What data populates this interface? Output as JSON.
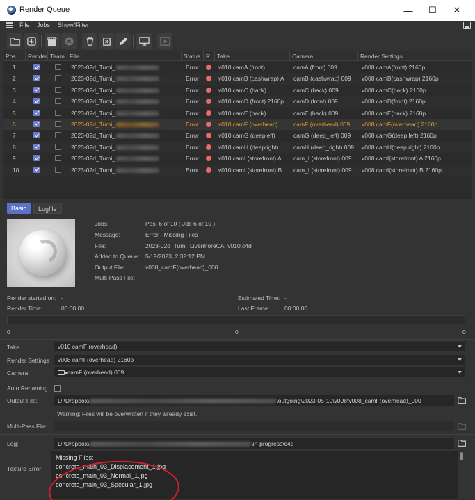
{
  "window": {
    "title": "Render Queue",
    "minimize": "—",
    "maximize": "☐",
    "close": "✕"
  },
  "menu": {
    "items": [
      "File",
      "Jobs",
      "Show/Filter"
    ]
  },
  "toolbar": {
    "icons": [
      "open-folder-icon",
      "download-icon",
      "clapperboard-icon",
      "stop-icon",
      "delete-icon",
      "delete-all-icon",
      "edit-icon",
      "monitor-icon",
      "render-view-icon"
    ]
  },
  "table": {
    "columns": [
      "Pos.",
      "Render",
      "Team",
      "File",
      "Status",
      "R",
      "Take",
      "Camera",
      "Render Settings"
    ],
    "rows": [
      {
        "pos": "1",
        "render": true,
        "team": false,
        "file": "2023-02d_Tumi_",
        "status": "Error",
        "take": "v010 camA (front)",
        "camera": "camA (front) 009",
        "settings": "v008.camA(front) 2160p"
      },
      {
        "pos": "2",
        "render": true,
        "team": false,
        "file": "2023-02d_Tumi_",
        "status": "Error",
        "take": "v010 camB (cashwrap) A",
        "camera": "camB (cashwrap) 009",
        "settings": "v008 camB(cashwrap) 2160p"
      },
      {
        "pos": "3",
        "render": true,
        "team": false,
        "file": "2023-02d_Tumi_",
        "status": "Error",
        "take": "v010 camC (back)",
        "camera": "camC (back) 009",
        "settings": "v008 camC(back) 2160p"
      },
      {
        "pos": "4",
        "render": true,
        "team": false,
        "file": "2023-02d_Tumi_",
        "status": "Error",
        "take": "v010 camD (front) 2160p",
        "camera": "camD (front) 009",
        "settings": "v008 camD(front) 2160p"
      },
      {
        "pos": "5",
        "render": true,
        "team": false,
        "file": "2023-02d_Tumi_",
        "status": "Error",
        "take": "v010 camE (back)",
        "camera": "camE (back) 009",
        "settings": "v008 camE(back) 2160p"
      },
      {
        "pos": "6",
        "render": true,
        "team": false,
        "file": "2023-02d_Tumi_",
        "status": "Error",
        "take": "v010 camF (overhead)",
        "camera": "camF (overhead) 009",
        "settings": "v008 camF(overhead) 2160p",
        "selected": true
      },
      {
        "pos": "7",
        "render": true,
        "team": false,
        "file": "2023-02d_Tumi_",
        "status": "Error",
        "take": "v010 camG (deepleft)",
        "camera": "camG (deep_left) 009",
        "settings": "v008 camG(deep.left) 2160p"
      },
      {
        "pos": "8",
        "render": true,
        "team": false,
        "file": "2023-02d_Tumi_",
        "status": "Error",
        "take": "v010 camH (deepright)",
        "camera": "camH (deep_right) 009",
        "settings": "v008 camH(deep.right) 2160p"
      },
      {
        "pos": "9",
        "render": true,
        "team": false,
        "file": "2023-02d_Tumi_",
        "status": "Error",
        "take": "v010 camI (storefront) A",
        "camera": "cam_I (storefront) 009",
        "settings": "v008 camI(storefront) A 2160p"
      },
      {
        "pos": "10",
        "render": true,
        "team": false,
        "file": "2023-02d_Tumi_",
        "status": "Error",
        "take": "v010 camI (storefront) B",
        "camera": "cam_I (storefront) 009",
        "settings": "v008 camI(storefront) B 2160p"
      }
    ]
  },
  "tabs": [
    "Basic",
    "Logfile"
  ],
  "info": {
    "labels": [
      "Jobs:",
      "Message:",
      "File:",
      "Added to Queue:",
      "Output File:",
      "Multi-Pass File:"
    ],
    "values": [
      "Pos. 6 of 10 ( Job 6 of 10 )",
      "Error - Missing Files",
      "2023-02d_Tumi_LivermoreCA_v010.c4d",
      "5/19/2023, 2:32:12 PM",
      "v008_camF(overhead)_000",
      ""
    ]
  },
  "stats": {
    "render_started_label": "Render started on:",
    "render_started_value": "-",
    "estimated_time_label": "Estimated Time:",
    "estimated_time_value": "-",
    "render_time_label": "Render Time:",
    "render_time_value": "00:00:00",
    "last_frame_label": "Last Frame:",
    "last_frame_value": "00:00:00"
  },
  "progress": {
    "value": 0,
    "label_left": "0",
    "label_mid": "0",
    "label_right": "0"
  },
  "form": {
    "take_label": "Take",
    "take_value": "v010 camF (overhead)",
    "render_settings_label": "Render Settings",
    "render_settings_value": "v008 camF(overhead) 2160p",
    "camera_label": "Camera",
    "camera_value": "camF (overhead) 009",
    "auto_renaming_label": "Auto Renaming",
    "output_file_label": "Output File:",
    "output_prefix": "D:\\Dropbox\\",
    "output_suffix": "\\outgoing\\2023-05-10\\v008\\v008_camF(overhead)_000",
    "warning": "Warning: Files will be overwritten if they already exist.",
    "multipass_label": "Multi-Pass File:",
    "log_label": "Log:",
    "log_prefix": "D:\\Dropbox\\",
    "log_suffix": "\\in-progress\\c4d",
    "texture_error_label": "Texture Error:",
    "texture_error_lines": [
      "Missing Files:",
      "concrete_main_03_Displacement_1.jpg",
      "concrete_main_03_Normal_1.jpg",
      "concrete_main_03_Specular_1.jpg"
    ]
  },
  "colors": {
    "background": "#333333",
    "accent": "#5a72c8",
    "selected_row_text": "#e39a2e",
    "error_dot": "#e86a6a",
    "annotation_circle": "#d4202a"
  }
}
